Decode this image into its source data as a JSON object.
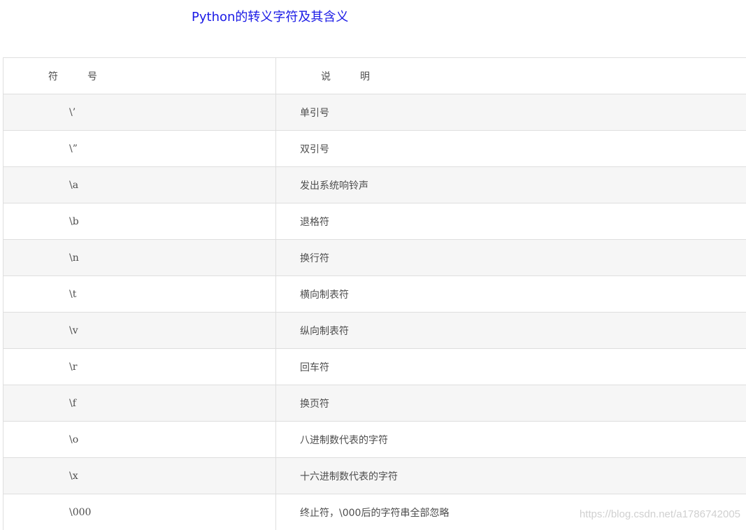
{
  "title": "Python的转义字符及其含义",
  "table": {
    "headers": {
      "symbol": "符　　　号",
      "description": "说　　　明"
    },
    "rows": [
      {
        "symbol": "\\’",
        "description": "单引号"
      },
      {
        "symbol": "\\”",
        "description": "双引号"
      },
      {
        "symbol": "\\a",
        "description": "发出系统响铃声"
      },
      {
        "symbol": "\\b",
        "description": "退格符"
      },
      {
        "symbol": "\\n",
        "description": "换行符"
      },
      {
        "symbol": "\\t",
        "description": "横向制表符"
      },
      {
        "symbol": "\\v",
        "description": "纵向制表符"
      },
      {
        "symbol": "\\r",
        "description": "回车符"
      },
      {
        "symbol": "\\f",
        "description": "换页符"
      },
      {
        "symbol": "\\o",
        "description": "八进制数代表的字符"
      },
      {
        "symbol": "\\x",
        "description": "十六进制数代表的字符"
      },
      {
        "symbol": "\\000",
        "description": "终止符，\\000后的字符串全部忽略"
      }
    ]
  },
  "watermark": "https://blog.csdn.net/a1786742005",
  "colors": {
    "title": "#1a1ae6",
    "text": "#4d4d4d",
    "row_alt": "#f6f6f6",
    "border": "#dedede"
  }
}
